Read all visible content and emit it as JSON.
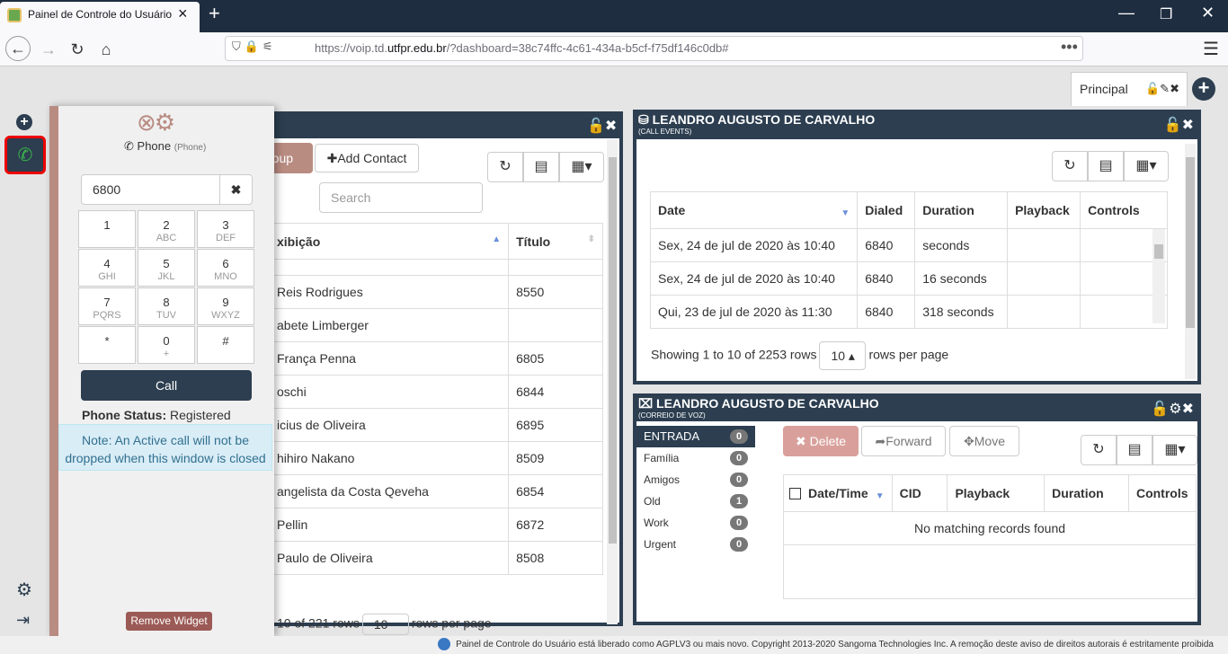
{
  "browser": {
    "tab_title": "Painel de Controle do Usuário -",
    "url_prefix": "https://voip.td.",
    "url_domain": "utfpr.edu.br",
    "url_suffix": "/?dashboard=38c74ffc-4c61-434a-b5cf-f75df146c0db#"
  },
  "dashboard": {
    "tab_label": "Principal"
  },
  "contacts_widget": {
    "group_button": "roup",
    "add_contact": "Add Contact",
    "search_placeholder": "Search",
    "col_name": "xibição",
    "col_title": "Título",
    "rows": [
      {
        "name": "",
        "title": ""
      },
      {
        "name": "Reis Rodrigues",
        "title": "8550"
      },
      {
        "name": "abete Limberger",
        "title": ""
      },
      {
        "name": "França Penna",
        "title": "6805"
      },
      {
        "name": "oschi",
        "title": "6844"
      },
      {
        "name": "icius de Oliveira",
        "title": "6895"
      },
      {
        "name": "hihiro Nakano",
        "title": "8509"
      },
      {
        "name": "angelista da Costa Qeveha",
        "title": "6854"
      },
      {
        "name": "Pellin",
        "title": "6872"
      },
      {
        "name": "Paulo de Oliveira",
        "title": "8508"
      }
    ],
    "footer_rows": "10 of 221 rows",
    "page_size": "10",
    "footer_per_page": "rows per page"
  },
  "phone": {
    "title": "Phone",
    "subtitle": "(Phone)",
    "number": "6800",
    "keys": [
      {
        "d": "1",
        "l": ""
      },
      {
        "d": "2",
        "l": "ABC"
      },
      {
        "d": "3",
        "l": "DEF"
      },
      {
        "d": "4",
        "l": "GHI"
      },
      {
        "d": "5",
        "l": "JKL"
      },
      {
        "d": "6",
        "l": "MNO"
      },
      {
        "d": "7",
        "l": "PQRS"
      },
      {
        "d": "8",
        "l": "TUV"
      },
      {
        "d": "9",
        "l": "WXYZ"
      },
      {
        "d": "*",
        "l": ""
      },
      {
        "d": "0",
        "l": "+"
      },
      {
        "d": "#",
        "l": ""
      }
    ],
    "call_label": "Call",
    "status_label": "Phone Status:",
    "status_value": "Registered",
    "note": "Note: An Active call will not be dropped when this window is closed",
    "remove_widget": "Remove Widget"
  },
  "call_events": {
    "title": "LEANDRO AUGUSTO DE CARVALHO",
    "subtitle": "(CALL EVENTS)",
    "headers": [
      "Date",
      "Dialed",
      "Duration",
      "Playback",
      "Controls"
    ],
    "rows": [
      {
        "date": "Sex, 24 de jul de 2020 às 10:40",
        "dialed": "6840",
        "duration": "seconds"
      },
      {
        "date": "Sex, 24 de jul de 2020 às 10:40",
        "dialed": "6840",
        "duration": "16 seconds"
      },
      {
        "date": "Qui, 23 de jul de 2020 às 11:30",
        "dialed": "6840",
        "duration": "318 seconds"
      }
    ],
    "footer_showing": "Showing 1 to 10 of 2253 rows",
    "page_size": "10",
    "footer_per_page": "rows per page"
  },
  "voicemail": {
    "title": "LEANDRO AUGUSTO DE CARVALHO",
    "subtitle": "(CORREIO DE VOZ)",
    "folders": [
      {
        "name": "ENTRADA",
        "count": "0"
      },
      {
        "name": "Família",
        "count": "0"
      },
      {
        "name": "Amigos",
        "count": "0"
      },
      {
        "name": "Old",
        "count": "1"
      },
      {
        "name": "Work",
        "count": "0"
      },
      {
        "name": "Urgent",
        "count": "0"
      }
    ],
    "delete": "Delete",
    "forward": "Forward",
    "move": "Move",
    "headers": [
      "Date/Time",
      "CID",
      "Playback",
      "Duration",
      "Controls"
    ],
    "empty": "No matching records found"
  },
  "footer": {
    "text": "Painel de Controle do Usuário está liberado como AGPLV3 ou mais novo. Copyright 2013-2020 Sangoma Technologies Inc. A remoção deste aviso de direitos autorais é estritamente proibida"
  }
}
